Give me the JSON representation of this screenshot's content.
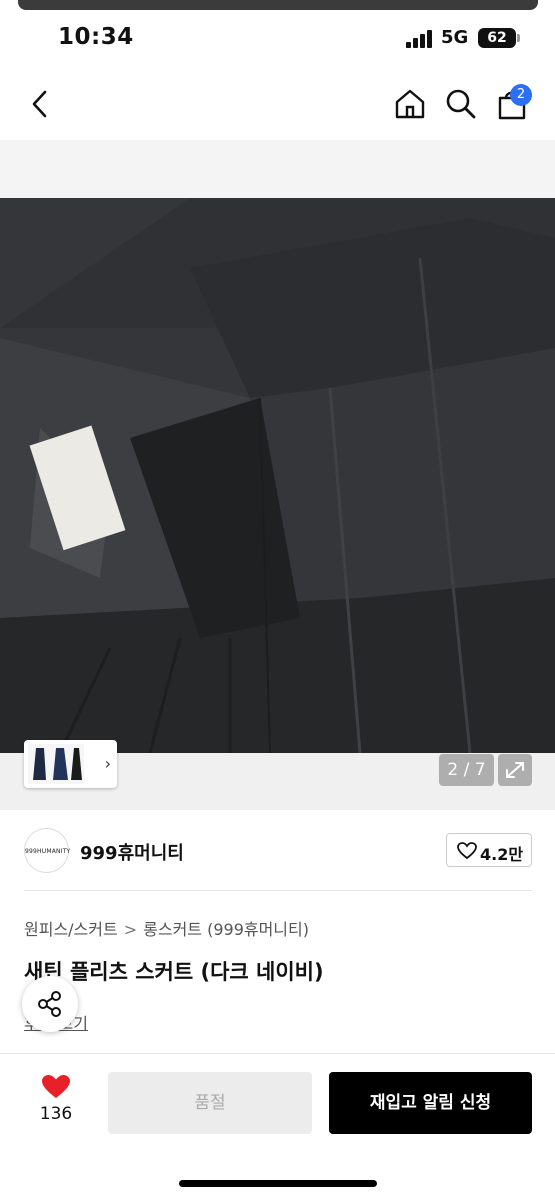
{
  "status_bar": {
    "time": "10:34",
    "network": "5G",
    "battery": "62"
  },
  "nav": {
    "back_icon": "chevron-left-icon",
    "home_icon": "home-icon",
    "search_icon": "search-icon",
    "cart_icon": "shopping-bag-icon",
    "cart_count": "2"
  },
  "gallery": {
    "page_indicator": "2 / 7",
    "thumbnail_chevron": "›",
    "expand_icon": "expand-icon"
  },
  "brand": {
    "logo_text": "999HUMANITY",
    "name": "999휴머니티",
    "likes": "4.2만"
  },
  "product": {
    "breadcrumb": [
      "원피스/스커트",
      "롱스커트 (999휴머니티)"
    ],
    "breadcrumb_separator": ">",
    "title": "새틴 플리츠 스커트 (다크 네이비)",
    "review_link": "후기 보기"
  },
  "bottom_bar": {
    "wish_count": "136",
    "soldout_label": "품절",
    "restock_label": "재입고 알림 신청"
  },
  "colors": {
    "accent_badge": "#2b6ff7",
    "wish_heart": "#e8202a",
    "primary_button": "#000000"
  }
}
